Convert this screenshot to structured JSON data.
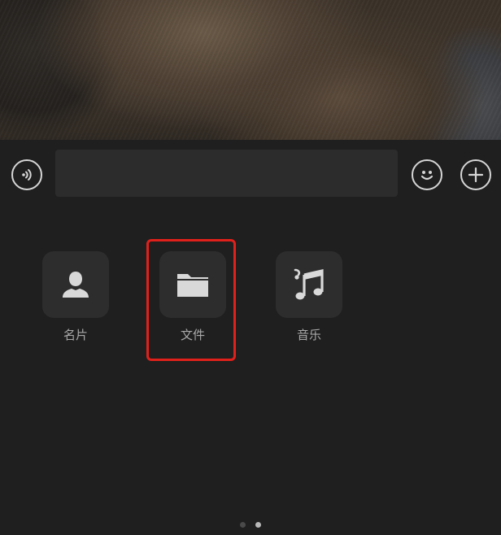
{
  "input_bar": {
    "message_value": "",
    "voice_icon": "voice-icon",
    "emoji_icon": "emoji-icon",
    "plus_icon": "plus-icon"
  },
  "panel": {
    "items": [
      {
        "label": "名片",
        "icon": "person-icon"
      },
      {
        "label": "文件",
        "icon": "folder-icon"
      },
      {
        "label": "音乐",
        "icon": "music-note-icon"
      }
    ],
    "highlight_color": "#e0201b",
    "pager": {
      "current_page": 2,
      "total_pages": 2
    }
  },
  "colors": {
    "background": "#1f1f1f",
    "tile": "#2d2d2d",
    "icon": "#d9d9d9",
    "label": "#a9a9a9"
  }
}
